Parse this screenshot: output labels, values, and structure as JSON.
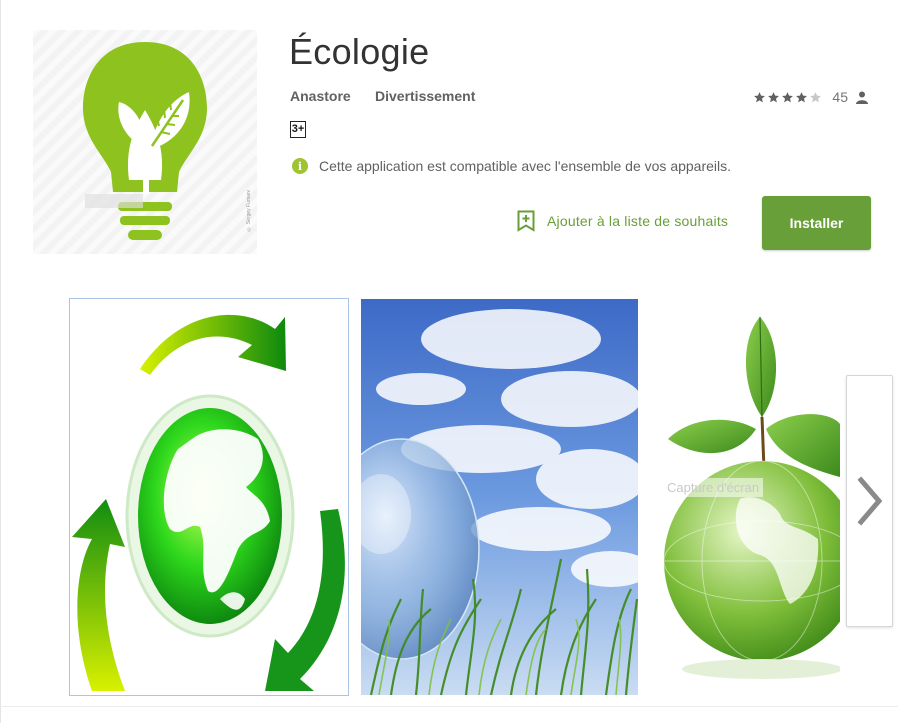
{
  "app": {
    "title": "Écologie",
    "developer": "Anastore",
    "category": "Divertissement",
    "rating_stars": 4,
    "rating_max": 5,
    "rating_count": "45",
    "content_rating": "3+",
    "compatibility_text": "Cette application est compatible avec l'ensemble de vos appareils.",
    "icon_credit": "© Sergey Furtaev"
  },
  "actions": {
    "wishlist_label": "Ajouter à la liste de souhaits",
    "install_label": "Installer"
  },
  "screenshots": {
    "caption": "Capture d'écran",
    "items": [
      "eco-globe-arrows",
      "glass-globe-sky-grass",
      "glass-globe-leaves"
    ]
  },
  "icons": [
    "lightbulb-leaf-icon",
    "star-icon",
    "person-icon",
    "info-icon",
    "bookmark-icon",
    "chevron-right-icon"
  ],
  "colors": {
    "accent": "#689f38",
    "icon_green": "#8dc21f",
    "info_green": "#9ec433",
    "star_filled": "#616161",
    "star_empty": "#c8c8c8"
  }
}
